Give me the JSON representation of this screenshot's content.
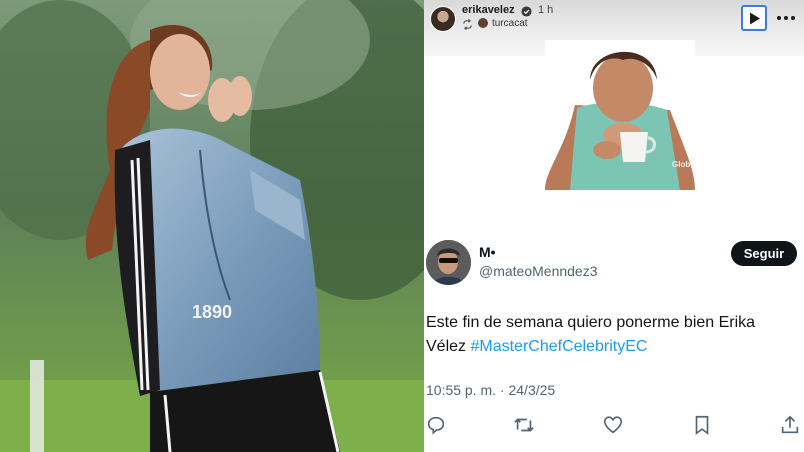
{
  "story": {
    "username": "erikavelez",
    "time": "1 h",
    "music_user": "turcacat"
  },
  "gif": {
    "watermark": "Glob"
  },
  "photo": {
    "jacket_text": "1890"
  },
  "tweet": {
    "name": "M•",
    "handle": "@mateoMenndez3",
    "follow_label": "Seguir",
    "text": "Este fin de semana quiero ponerme bien Erika Vélez ",
    "hashtag": "#MasterChefCelebrityEC",
    "timestamp": "10:55 p. m. · 24/3/25"
  },
  "icons": {
    "verified": "verified-badge-icon",
    "repost": "repost-icon",
    "play": "play-icon",
    "more": "more-dots-icon",
    "reply": "reply-icon",
    "retweet": "retweet-icon",
    "like": "heart-icon",
    "bookmark": "bookmark-icon",
    "share": "share-icon"
  },
  "colors": {
    "accent": "#1d9bf0",
    "follow_button": "#0f1419",
    "play_border": "#3c7be0"
  }
}
